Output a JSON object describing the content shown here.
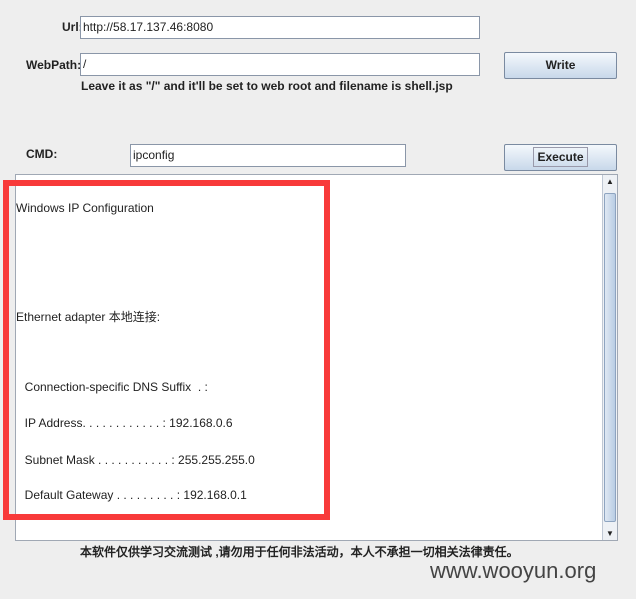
{
  "form": {
    "url_label": "Url:",
    "url_value": "http://58.17.137.46:8080",
    "webpath_label": "WebPath:",
    "webpath_value": "/",
    "hint": "Leave it as \"/\" and it'll be set to web root and filename is shell.jsp",
    "write_label": "Write",
    "cmd_label": "CMD:",
    "cmd_value": "ipconfig",
    "execute_label": "Execute"
  },
  "output": {
    "lines": [
      "Windows IP Configuration",
      "Ethernet adapter 本地连接:",
      "  Connection-specific DNS Suffix  . :",
      "  IP Address. . . . . . . . . . . . : 192.168.0.6",
      "  Subnet Mask . . . . . . . . . . . : 255.255.255.0",
      "  Default Gateway . . . . . . . . . : 192.168.0.1"
    ]
  },
  "disclaimer": "本软件仅供学习交流测试 ,请勿用于任何非法活动，本人不承担一切相关法律责任。",
  "watermark": "www.wooyun.org",
  "colors": {
    "highlight": "#f83a3a"
  }
}
